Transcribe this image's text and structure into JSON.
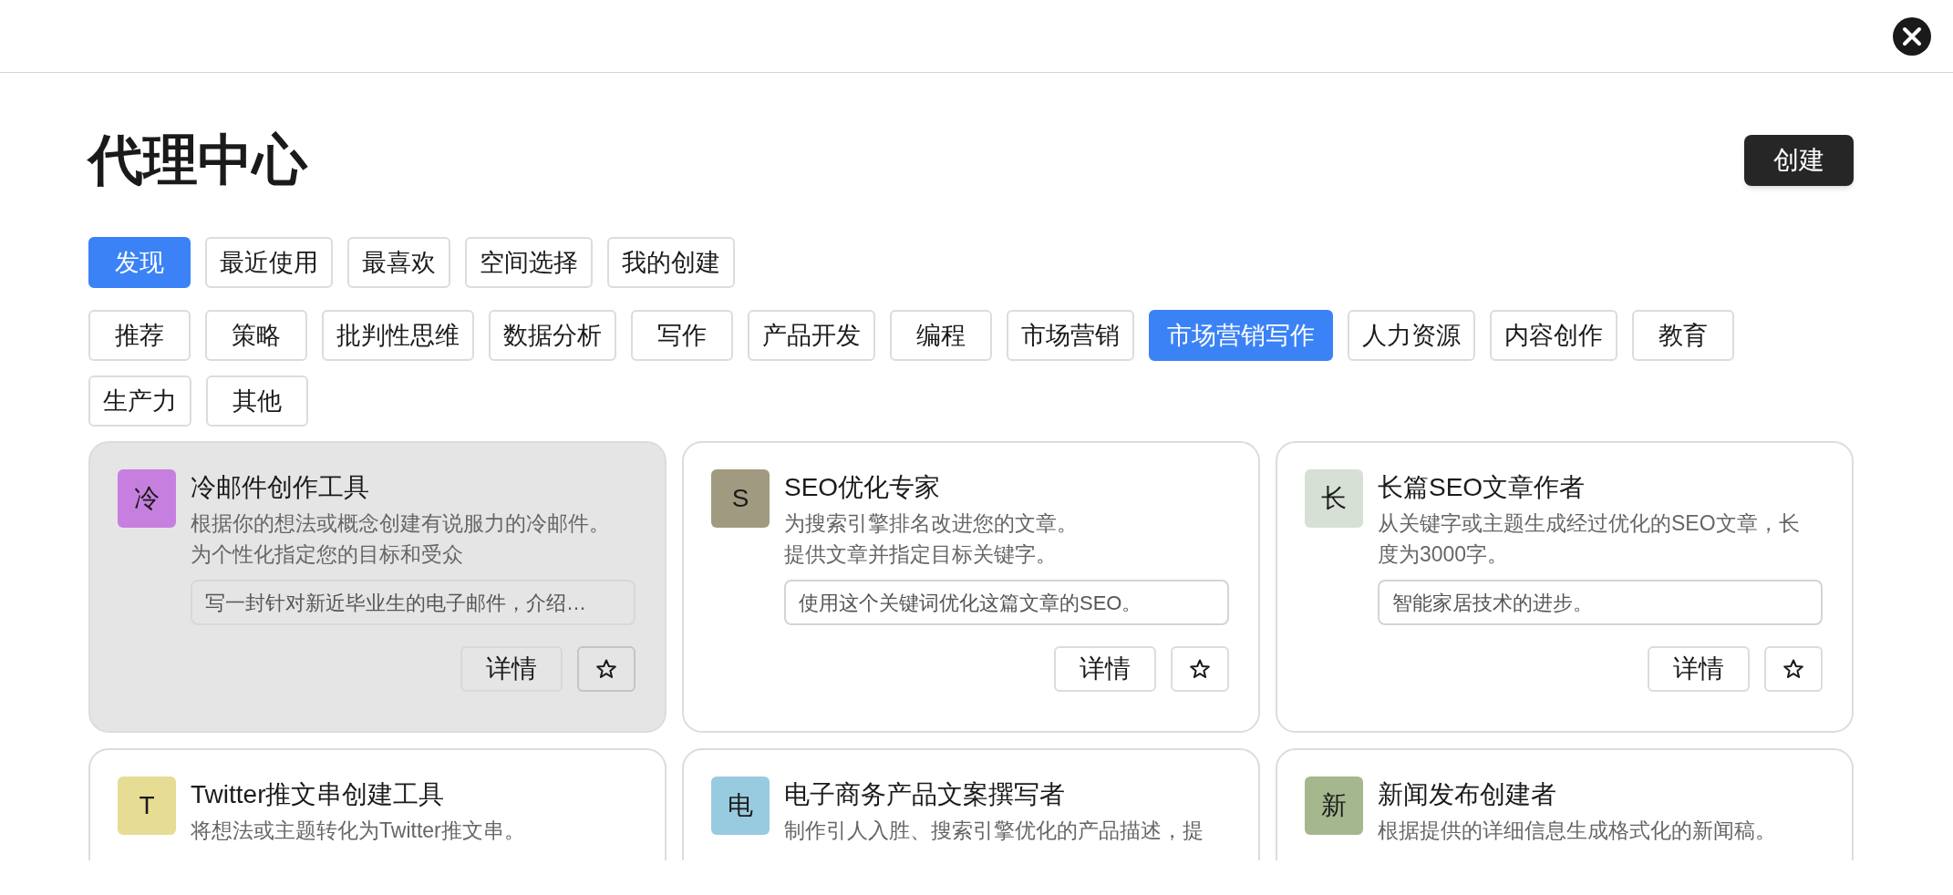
{
  "title": "代理中心",
  "create_button": "创建",
  "tabs": [
    {
      "label": "发现",
      "selected": true
    },
    {
      "label": "最近使用",
      "selected": false
    },
    {
      "label": "最喜欢",
      "selected": false
    },
    {
      "label": "空间选择",
      "selected": false
    },
    {
      "label": "我的创建",
      "selected": false
    }
  ],
  "categories": [
    {
      "label": "推荐",
      "selected": false
    },
    {
      "label": "策略",
      "selected": false
    },
    {
      "label": "批判性思维",
      "selected": false
    },
    {
      "label": "数据分析",
      "selected": false
    },
    {
      "label": "写作",
      "selected": false
    },
    {
      "label": "产品开发",
      "selected": false
    },
    {
      "label": "编程",
      "selected": false
    },
    {
      "label": "市场营销",
      "selected": false
    },
    {
      "label": "市场营销写作",
      "selected": true
    },
    {
      "label": "人力资源",
      "selected": false
    },
    {
      "label": "内容创作",
      "selected": false
    },
    {
      "label": "教育",
      "selected": false
    },
    {
      "label": "生产力",
      "selected": false
    },
    {
      "label": "其他",
      "selected": false
    }
  ],
  "agents": [
    {
      "avatar": "冷",
      "color": "#c77fdf",
      "name": "冷邮件创作工具",
      "description": [
        "根据你的想法或概念创建有说服力的冷邮件。",
        "为个性化指定您的目标和受众"
      ],
      "example": "写一封针对新近毕业生的电子邮件，介绍…",
      "details_button": "详情",
      "highlighted": true
    },
    {
      "avatar": "S",
      "color": "#a09a80",
      "name": "SEO优化专家",
      "description": [
        "为搜索引擎排名改进您的文章。",
        "提供文章并指定目标关键字。"
      ],
      "example": "使用这个关键词优化这篇文章的SEO。",
      "details_button": "详情",
      "highlighted": false
    },
    {
      "avatar": "长",
      "color": "#d6e0d5",
      "name": "长篇SEO文章作者",
      "description": [
        "从关键字或主题生成经过优化的SEO文章，长",
        "度为3000字。"
      ],
      "example": "智能家居技术的进步。",
      "details_button": "详情",
      "highlighted": false
    },
    {
      "avatar": "T",
      "color": "#e6dc94",
      "name": "Twitter推文串创建工具",
      "description": [
        "将想法或主题转化为Twitter推文串。"
      ],
      "highlighted": false
    },
    {
      "avatar": "电",
      "color": "#98cbdf",
      "name": "电子商务产品文案撰写者",
      "description": [
        "制作引人入胜、搜索引擎优化的产品描述，提"
      ],
      "highlighted": false
    },
    {
      "avatar": "新",
      "color": "#a5b78d",
      "name": "新闻发布创建者",
      "description": [
        "根据提供的详细信息生成格式化的新闻稿。"
      ],
      "highlighted": false
    }
  ]
}
